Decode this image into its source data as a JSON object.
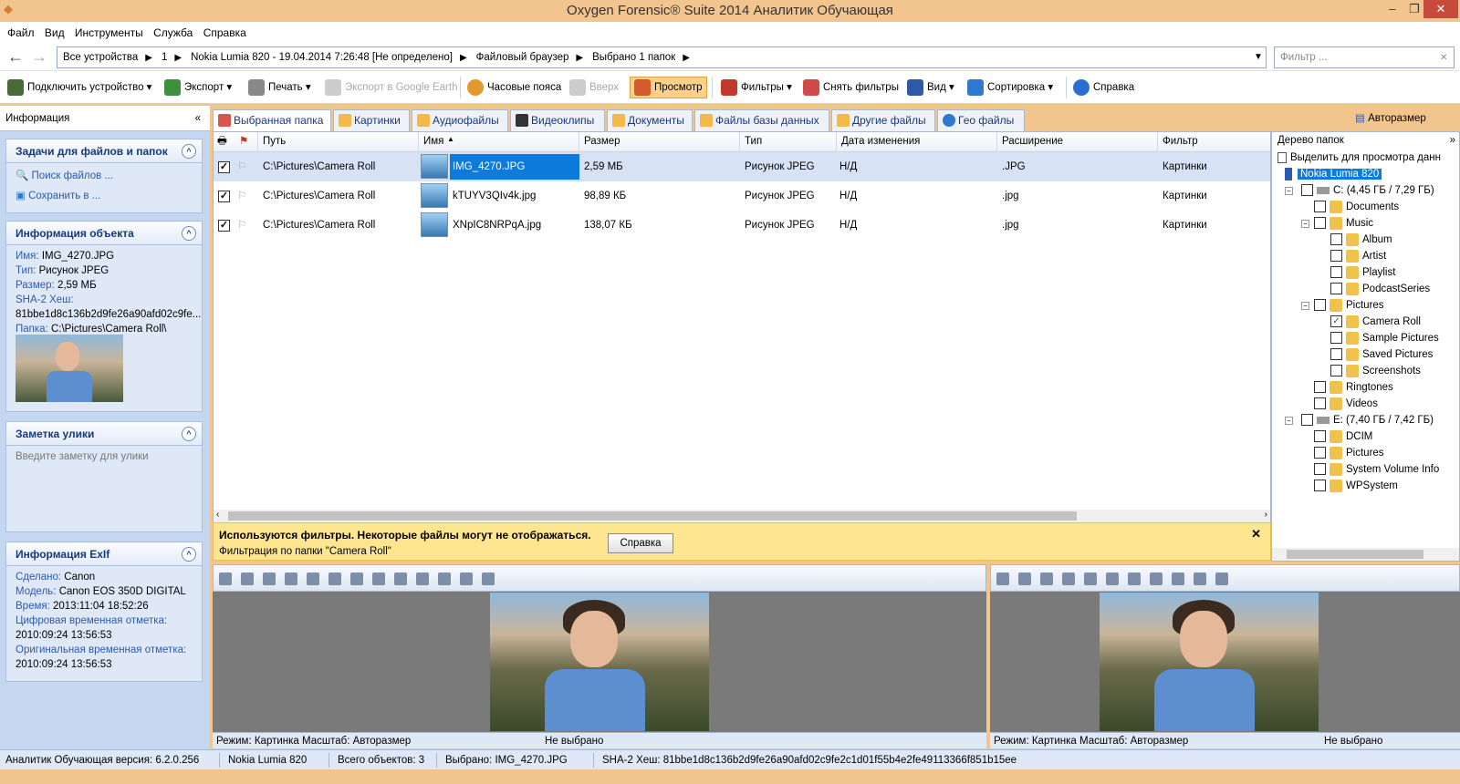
{
  "title": "Oxygen Forensic® Suite 2014 Аналитик Обучающая",
  "menu": [
    "Файл",
    "Вид",
    "Инструменты",
    "Служба",
    "Справка"
  ],
  "address": {
    "segments": [
      "Все устройства",
      "1",
      "Nokia Lumia 820 - 19.04.2014 7:26:48 [Не определено]",
      "Файловый браузер",
      "Выбрано 1 папок"
    ],
    "filter_placeholder": "Фильтр ..."
  },
  "toolbar": {
    "connect": "Подключить устройство",
    "export": "Экспорт",
    "print": "Печать",
    "google_earth": "Экспорт в Google Earth",
    "timezones": "Часовые пояса",
    "up": "Вверх",
    "preview": "Просмотр",
    "filters": "Фильтры",
    "clear_filters": "Снять фильтры",
    "view": "Вид",
    "sort": "Сортировка",
    "help": "Справка"
  },
  "left": {
    "header": "Информация",
    "tasks": {
      "title": "Задачи для файлов и папок",
      "search": "Поиск файлов ...",
      "save": "Сохранить в ..."
    },
    "object": {
      "title": "Информация объекта",
      "name_label": "Имя:",
      "name": "IMG_4270.JPG",
      "type_label": "Тип:",
      "type": "Рисунок JPEG",
      "size_label": "Размер:",
      "size": "2,59 МБ",
      "sha_label": "SHA-2 Хеш:",
      "sha": "81bbe1d8c136b2d9fe26a90afd02c9fe...",
      "folder_label": "Папка:",
      "folder": "C:\\Pictures\\Camera Roll\\"
    },
    "note": {
      "title": "Заметка улики",
      "placeholder": "Введите заметку для улики"
    },
    "exif": {
      "title": "Информация ExIf",
      "made_label": "Сделано:",
      "made": "Canon",
      "model_label": "Модель:",
      "model": "Canon EOS 350D DIGITAL",
      "time_label": "Время:",
      "time": "2013:11:04 18:52:26",
      "digital_label": "Цифровая временная отметка:",
      "digital": "2010:09:24 13:56:53",
      "original_label": "Оригинальная временная отметка:",
      "original": "2010:09:24 13:56:53"
    }
  },
  "tabs": [
    "Выбранная папка",
    "Картинки",
    "Аудиофайлы",
    "Видеоклипы",
    "Документы",
    "Файлы базы данных",
    "Другие файлы",
    "Гео файлы"
  ],
  "autosize": "Авторазмер",
  "grid": {
    "columns": [
      "Путь",
      "Имя",
      "Размер",
      "Тип",
      "Дата изменения",
      "Расширение",
      "Фильтр"
    ],
    "rows": [
      {
        "path": "C:\\Pictures\\Camera Roll",
        "name": "IMG_4270.JPG",
        "size": "2,59 МБ",
        "type": "Рисунок JPEG",
        "date": "Н/Д",
        "ext": ".JPG",
        "filter": "Картинки"
      },
      {
        "path": "C:\\Pictures\\Camera Roll",
        "name": "kTUYV3QIv4k.jpg",
        "size": "98,89 КБ",
        "type": "Рисунок JPEG",
        "date": "Н/Д",
        "ext": ".jpg",
        "filter": "Картинки"
      },
      {
        "path": "C:\\Pictures\\Camera Roll",
        "name": "XNpIC8NRPqA.jpg",
        "size": "138,07 КБ",
        "type": "Рисунок JPEG",
        "date": "Н/Д",
        "ext": ".jpg",
        "filter": "Картинки"
      }
    ]
  },
  "notice": {
    "bold": "Используются фильтры. Некоторые файлы могут не отображаться.",
    "sub": "Фильтрация по папки \"Camera Roll\"",
    "button": "Справка"
  },
  "tree": {
    "header": "Дерево папок",
    "select_hint": "Выделить для просмотра данн",
    "nodes": [
      "Nokia Lumia 820",
      "C: (4,45 ГБ / 7,29 ГБ)",
      "Documents",
      "Music",
      "Album",
      "Artist",
      "Playlist",
      "PodcastSeries",
      "Pictures",
      "Camera Roll",
      "Sample Pictures",
      "Saved Pictures",
      "Screenshots",
      "Ringtones",
      "Videos",
      "E: (7,40 ГБ / 7,42 ГБ)",
      "DCIM",
      "Pictures",
      "System Volume Info",
      "WPSystem"
    ]
  },
  "viewers": {
    "mode": "Режим: Картинка",
    "scale": "Масштаб: Авторазмер",
    "none": "Не выбрано"
  },
  "status": {
    "version": "Аналитик Обучающая версия: 6.2.0.256",
    "device": "Nokia Lumia 820",
    "total": "Всего объектов: 3",
    "selected": "Выбрано: IMG_4270.JPG",
    "sha": "SHA-2 Хеш: 81bbe1d8c136b2d9fe26a90afd02c9fe2c1d01f55b4e2fe49113366f851b15ee"
  }
}
